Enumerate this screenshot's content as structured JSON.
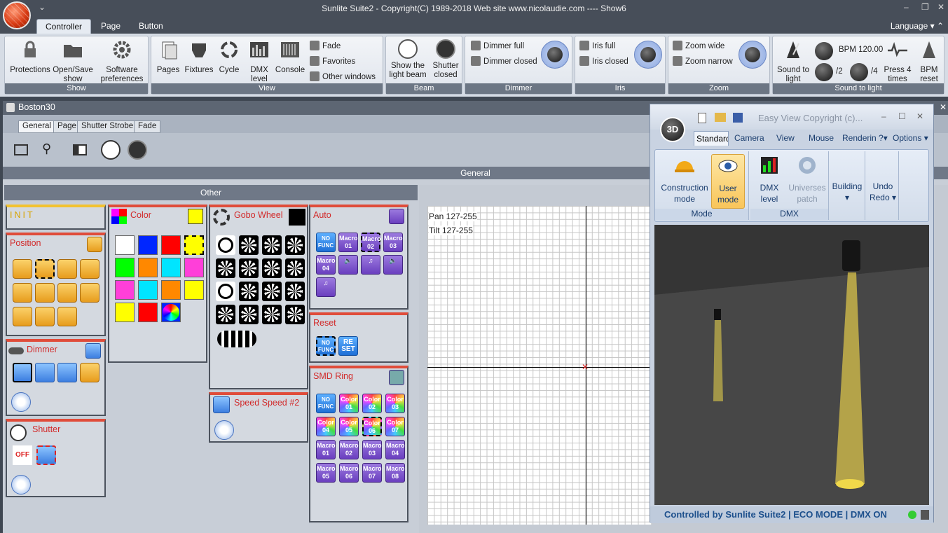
{
  "app": {
    "title": "Sunlite Suite2 - Copyright(C) 1989-2018   Web site www.nicolaudie.com ---- Show6",
    "language": "Language"
  },
  "ribbon_tabs": [
    "Controller",
    "Page",
    "Button"
  ],
  "groups": {
    "show": {
      "label": "Show",
      "buttons": [
        "Protections",
        "Open/Save show",
        "Software preferences"
      ]
    },
    "view": {
      "label": "View",
      "buttons": [
        "Pages",
        "Fixtures",
        "Cycle",
        "DMX level",
        "Console"
      ],
      "small": [
        "Fade",
        "Favorites",
        "Other windows"
      ]
    },
    "beam": {
      "label": "Beam",
      "buttons": [
        "Show the light beam",
        "Shutter closed"
      ]
    },
    "dimmer": {
      "label": "Dimmer",
      "small": [
        "Dimmer full",
        "Dimmer closed"
      ]
    },
    "iris": {
      "label": "Iris",
      "small": [
        "Iris full",
        "Iris closed"
      ]
    },
    "zoom": {
      "label": "Zoom",
      "small": [
        "Zoom wide",
        "Zoom narrow"
      ]
    },
    "stl": {
      "label": "Sound to light",
      "buttons": [
        "Sound to light",
        "Press 4 times",
        "BPM reset"
      ],
      "bpm": "BPM 120.00",
      "half": "/2",
      "quarter": "/4"
    }
  },
  "boston": {
    "title": "Boston30",
    "tabs": [
      "General",
      "Page",
      "Shutter Strobe",
      "Fade"
    ],
    "general": "General",
    "other": "Other"
  },
  "panels": {
    "init": "INIT",
    "position": "Position",
    "color": "Color",
    "gobo": "Gobo Wheel",
    "auto": "Auto",
    "dimmer": "Dimmer",
    "shutter": "Shutter",
    "speed": "Speed Speed #2",
    "reset": "Reset",
    "smd": "SMD Ring"
  },
  "macros": {
    "nofunc": "NO FUNC",
    "auto": [
      "Macro 01",
      "Macro 02",
      "Macro 03",
      "Macro 04"
    ],
    "smd_colors": [
      "Color 01",
      "Color 02",
      "Color 03",
      "Color 04",
      "Color 05",
      "Color 06",
      "Color 07"
    ],
    "smd_macros": [
      "Macro 01",
      "Macro 02",
      "Macro 03",
      "Macro 04",
      "Macro 05",
      "Macro 06",
      "Macro 07",
      "Macro 08"
    ],
    "reset": "RE SET",
    "off": "OFF"
  },
  "grid": {
    "pan": "Pan 127-255",
    "tilt": "Tilt 127-255"
  },
  "easyview": {
    "title": "Easy View   Copyright (c)...",
    "tabs": [
      "Standard",
      "Camera",
      "View",
      "Mouse",
      "Rendering"
    ],
    "help": "?",
    "options": "Options",
    "buttons": [
      "Construction mode",
      "User mode",
      "DMX level",
      "Universes patch",
      "Building",
      "Undo Redo"
    ],
    "group_mode": "Mode",
    "group_dmx": "DMX",
    "status": "Controlled by Sunlite Suite2  |  ECO MODE  |  DMX ON"
  },
  "colors": {
    "swatches": [
      "#ffffff",
      "#0026ff",
      "#ff0000",
      "#ffff00",
      "#00ff00",
      "#ff8800",
      "#00e5ff",
      "#ff3fd9"
    ]
  }
}
